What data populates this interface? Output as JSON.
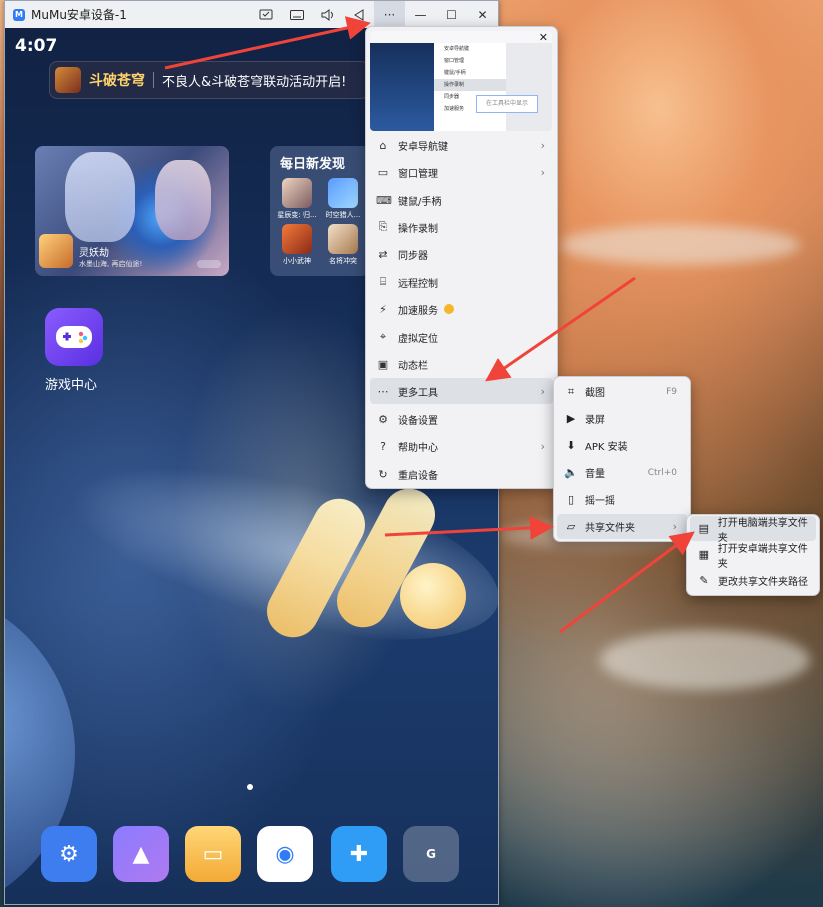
{
  "window": {
    "title": "MuMu安卓设备-1",
    "toolbar_icons": [
      "screenshot-icon",
      "keyboard-icon",
      "volume-icon",
      "back-icon",
      "more-icon"
    ],
    "more_label": "···",
    "minimize_label": "—",
    "maximize_label": "☐",
    "close_label": "✕"
  },
  "android": {
    "clock": "4:07",
    "banner": {
      "game": "斗破苍穹",
      "text": "不良人&斗破苍穹联动活动开启!"
    },
    "game_card": {
      "name": "灵妖劫",
      "desc": "水墨山海, 再启仙途!"
    },
    "discover": {
      "title": "每日新发现",
      "items": [
        {
          "label": "星辰变: 归..."
        },
        {
          "label": "时空猎人..."
        },
        {
          "label": "小小武神"
        },
        {
          "label": "名将冲突"
        }
      ]
    },
    "game_center_label": "游戏中心",
    "dock": [
      "settings",
      "gallery",
      "files",
      "browser",
      "app-store",
      "google-folder"
    ]
  },
  "menu": {
    "preview": {
      "items": [
        "安卓导航键",
        "窗口管理",
        "键鼠/手柄",
        "操作录制",
        "同步器",
        "加速服务"
      ],
      "tooltip": "在工具栏中显示"
    },
    "items": [
      {
        "label": "安卓导航键",
        "icon": "⌂",
        "arrow": "›"
      },
      {
        "label": "窗口管理",
        "icon": "▭",
        "arrow": "›"
      },
      {
        "label": "键鼠/手柄",
        "icon": "⌨",
        "arrow": ""
      },
      {
        "label": "操作录制",
        "icon": "⎘",
        "arrow": ""
      },
      {
        "label": "同步器",
        "icon": "⇄",
        "arrow": ""
      },
      {
        "label": "远程控制",
        "icon": "⌸",
        "arrow": ""
      },
      {
        "label": "加速服务",
        "icon": "⚡",
        "arrow": ""
      },
      {
        "label": "虚拟定位",
        "icon": "⌖",
        "arrow": ""
      },
      {
        "label": "动态栏",
        "icon": "▣",
        "arrow": ""
      },
      {
        "label": "更多工具",
        "icon": "⋯",
        "arrow": "›"
      },
      {
        "label": "设备设置",
        "icon": "⚙",
        "arrow": ""
      },
      {
        "label": "帮助中心",
        "icon": "?",
        "arrow": "›"
      },
      {
        "label": "重启设备",
        "icon": "↻",
        "arrow": ""
      }
    ]
  },
  "more_tools": [
    {
      "label": "截图",
      "icon": "⌗",
      "shortcut": "F9",
      "arrow": ""
    },
    {
      "label": "录屏",
      "icon": "▶",
      "shortcut": "",
      "arrow": ""
    },
    {
      "label": "APK 安装",
      "icon": "⬇",
      "shortcut": "",
      "arrow": ""
    },
    {
      "label": "音量",
      "icon": "🔈",
      "shortcut": "Ctrl+0",
      "arrow": ""
    },
    {
      "label": "摇一摇",
      "icon": "▯",
      "shortcut": "",
      "arrow": ""
    },
    {
      "label": "共享文件夹",
      "icon": "▱",
      "shortcut": "",
      "arrow": "›"
    }
  ],
  "shared_folder": [
    {
      "label": "打开电脑端共享文件夹",
      "icon": "▤"
    },
    {
      "label": "打开安卓端共享文件夹",
      "icon": "▦"
    },
    {
      "label": "更改共享文件夹路径",
      "icon": "✎"
    }
  ],
  "colors": {
    "arrow": "#f0443a",
    "accent": "#2f7cf6"
  }
}
